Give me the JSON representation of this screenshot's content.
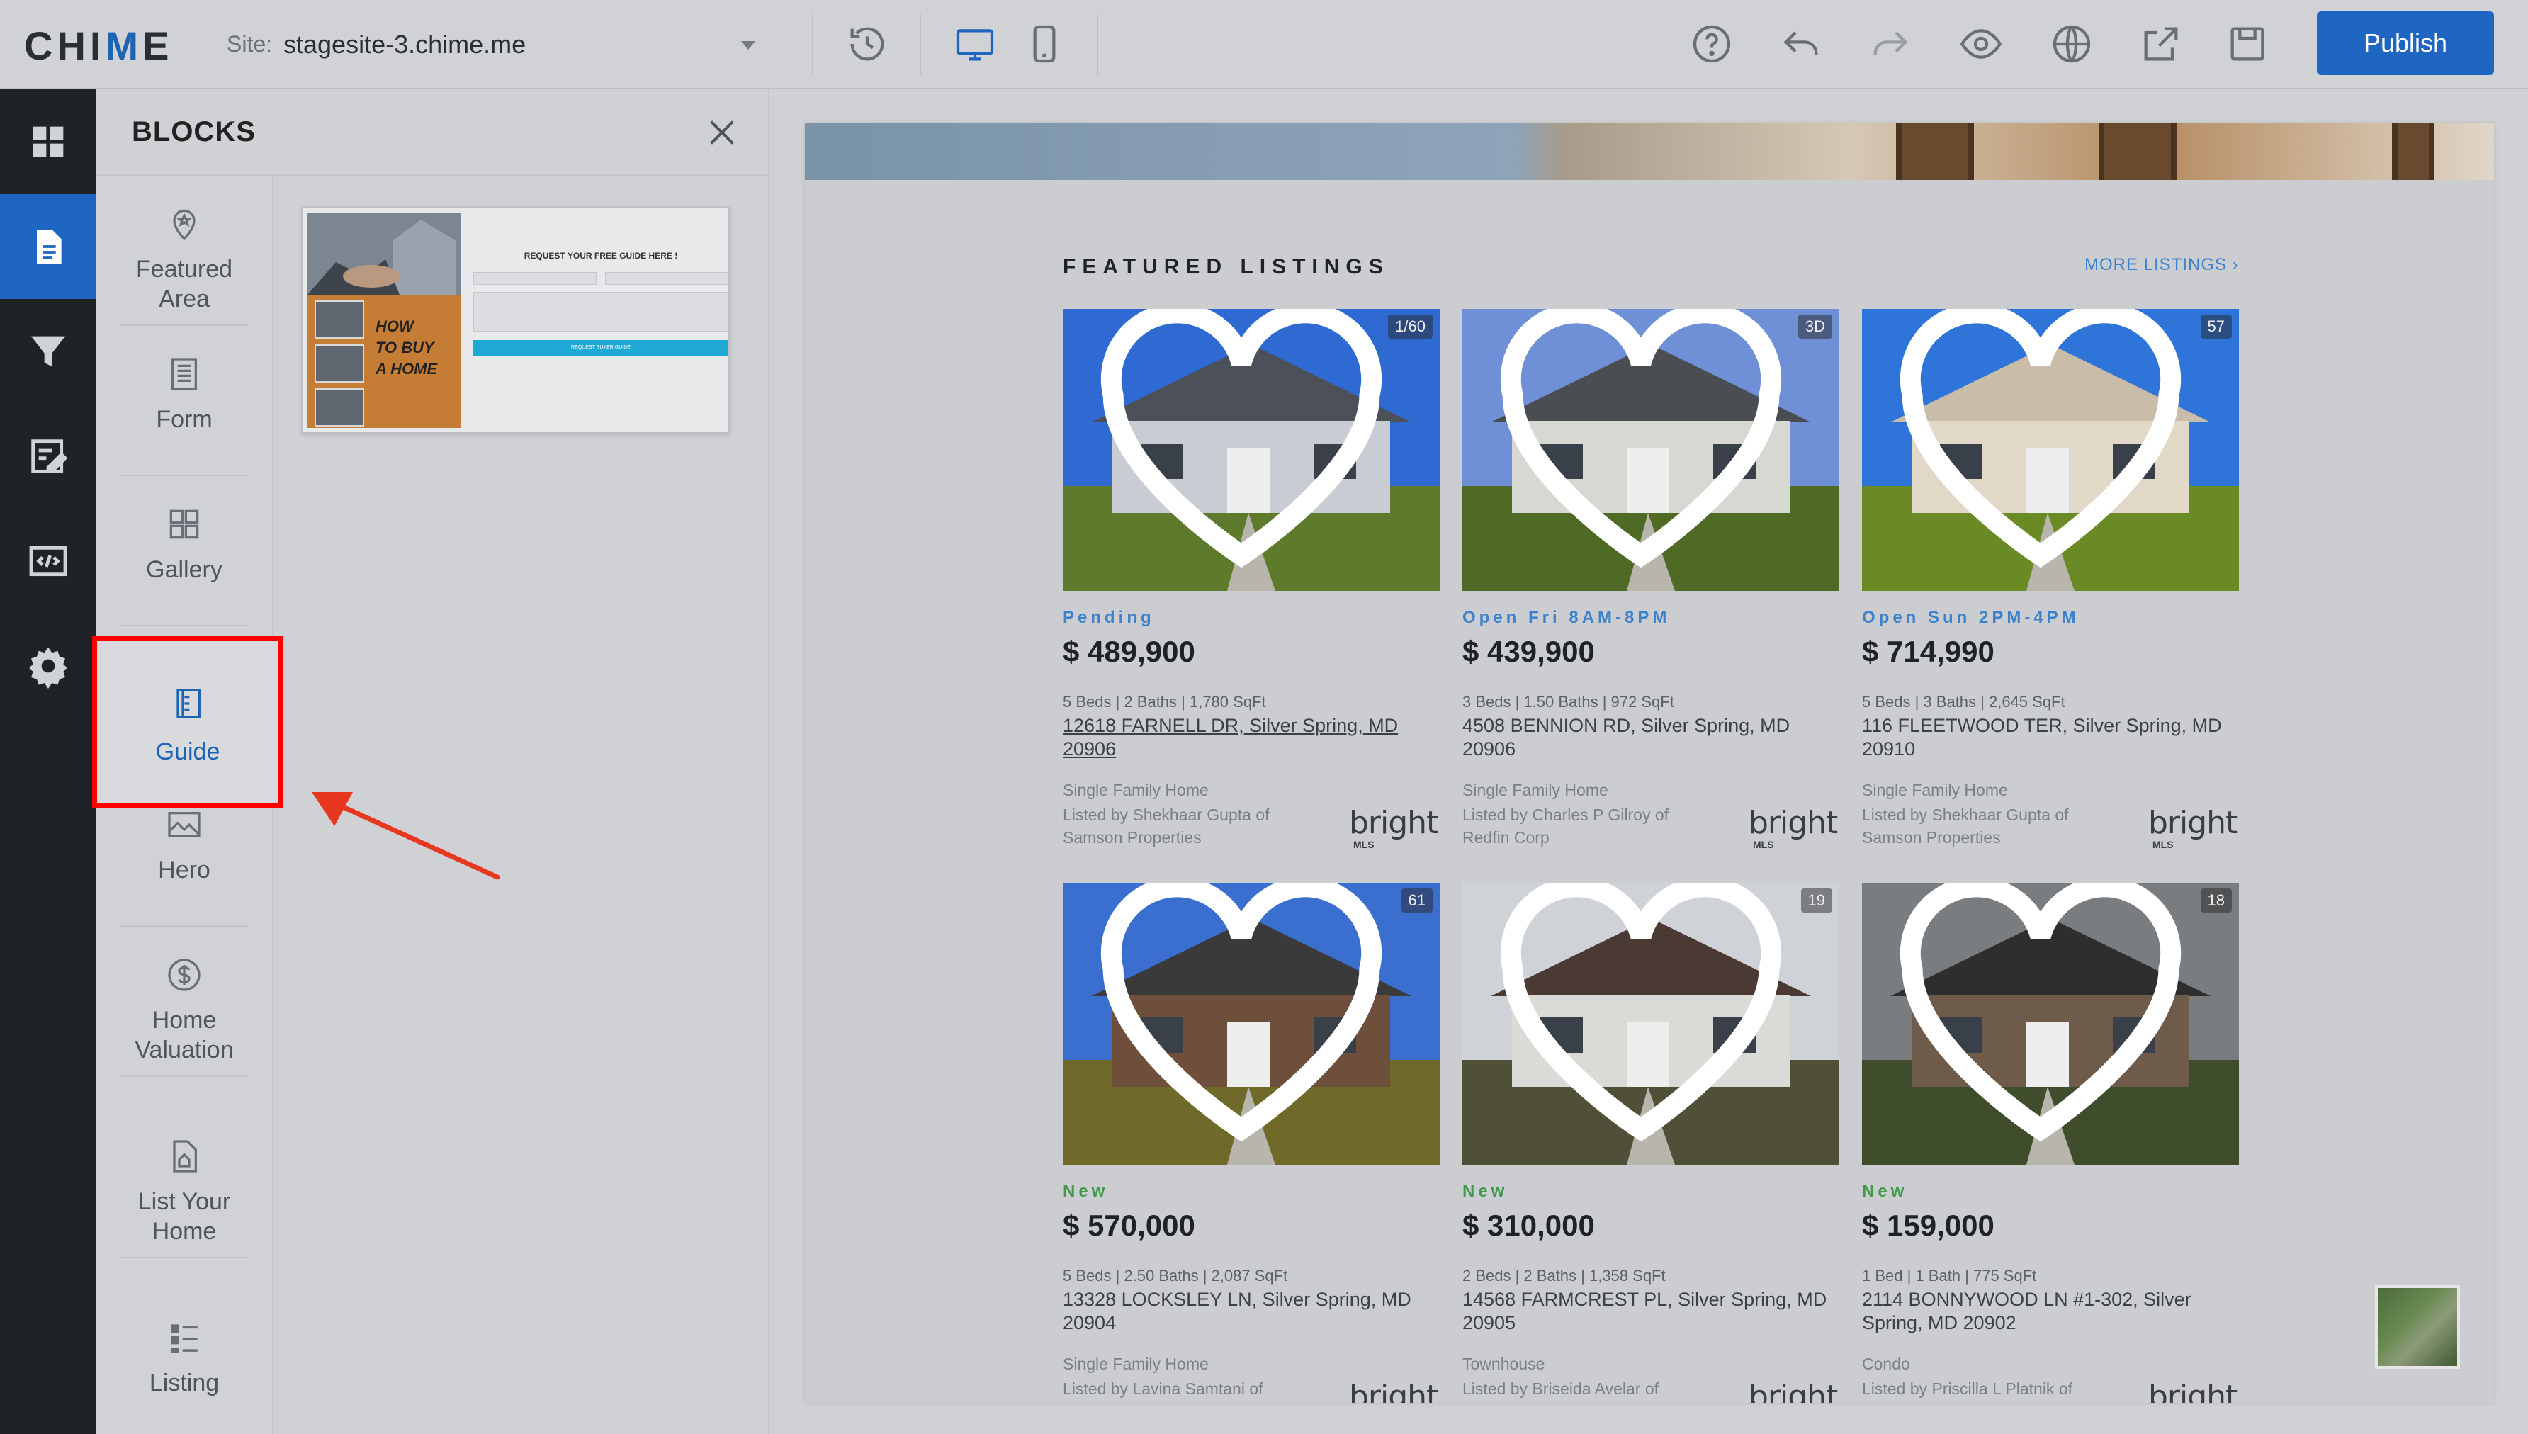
{
  "app": {
    "logo_text_a": "CHI",
    "logo_text_v": "M",
    "logo_text_b": "E"
  },
  "site_selector": {
    "label": "Site:",
    "value": "stagesite-3.chime.me"
  },
  "toolbar": {
    "icons": [
      "history-icon",
      "desktop-icon",
      "mobile-icon",
      "help-icon",
      "undo-icon",
      "redo-icon",
      "preview-icon",
      "globe-icon",
      "export-icon",
      "save-icon"
    ],
    "publish_label": "Publish"
  },
  "rail": {
    "items": [
      "dashboard-icon",
      "pages-icon",
      "funnel-icon",
      "edit-icon",
      "code-icon",
      "settings-icon"
    ],
    "active": "pages-icon"
  },
  "blocks_panel": {
    "title": "BLOCKS",
    "items": [
      {
        "label_1": "Featured",
        "label_2": "Area",
        "icon": "location-pin-icon"
      },
      {
        "label_1": "Form",
        "label_2": "",
        "icon": "form-icon"
      },
      {
        "label_1": "Gallery",
        "label_2": "",
        "icon": "gallery-icon"
      },
      {
        "label_1": "Guide",
        "label_2": "",
        "icon": "guide-icon"
      },
      {
        "label_1": "Hero",
        "label_2": "",
        "icon": "image-icon"
      },
      {
        "label_1": "Home",
        "label_2": "Valuation",
        "icon": "dollar-icon"
      },
      {
        "label_1": "List Your",
        "label_2": "Home",
        "icon": "document-house-icon"
      },
      {
        "label_1": "Listing",
        "label_2": "",
        "icon": "list-icon"
      }
    ],
    "selected": "Guide",
    "preview": {
      "howto_1": "HOW",
      "howto_2": "TO BUY",
      "howto_3": "A HOME",
      "title": "REQUEST YOUR FREE GUIDE HERE !",
      "button": "REQUEST BUYER GUIDE"
    }
  },
  "main": {
    "section_title": "FEATURED LISTINGS",
    "more_link": "MORE LISTINGS ›",
    "listings": [
      {
        "badge": "1/60",
        "status": "Pending",
        "status_color": "#3c82cc",
        "price": "$ 489,900",
        "specs": "5 Beds  |  2 Baths  |  1,780 SqFt",
        "address": "12618 FARNELL DR, Silver Spring, MD 20906",
        "type": "Single Family Home",
        "listed_by": "Listed by Shekhaar Gupta of Samson Properties"
      },
      {
        "badge": "3D",
        "status": "Open Fri 8AM-8PM",
        "status_color": "#3c82cc",
        "price": "$ 439,900",
        "specs": "3 Beds  |  1.50 Baths  |  972 SqFt",
        "address": "4508 BENNION RD, Silver Spring, MD 20906",
        "type": "Single Family Home",
        "listed_by": "Listed by Charles P Gilroy of Redfin Corp"
      },
      {
        "badge": "57",
        "status": "Open Sun 2PM-4PM",
        "status_color": "#3c82cc",
        "price": "$ 714,990",
        "specs": "5 Beds  |  3 Baths  |  2,645 SqFt",
        "address": "116 FLEETWOOD TER, Silver Spring, MD 20910",
        "type": "Single Family Home",
        "listed_by": "Listed by Shekhaar Gupta of Samson Properties"
      },
      {
        "badge": "61",
        "status": "New",
        "status_color": "#3f9a4c",
        "price": "$ 570,000",
        "specs": "5 Beds  |  2.50 Baths  |  2,087 SqFt",
        "address": "13328 LOCKSLEY LN, Silver Spring, MD 20904",
        "type": "Single Family Home",
        "listed_by": "Listed by Lavina Samtani of"
      },
      {
        "badge": "19",
        "status": "New",
        "status_color": "#3f9a4c",
        "price": "$ 310,000",
        "specs": "2 Beds  |  2 Baths  |  1,358 SqFt",
        "address": "14568 FARMCREST PL, Silver Spring, MD 20905",
        "type": "Townhouse",
        "listed_by": "Listed by Briseida Avelar of"
      },
      {
        "badge": "18",
        "status": "New",
        "status_color": "#3f9a4c",
        "price": "$ 159,000",
        "specs": "1 Bed  |  1 Bath  |  775 SqFt",
        "address": "2114 BONNYWOOD LN #1-302, Silver Spring, MD 20902",
        "type": "Condo",
        "listed_by": "Listed by Priscilla L Platnik of"
      }
    ],
    "mls_logo": "bright",
    "mls_logo_sub": "MLS"
  }
}
